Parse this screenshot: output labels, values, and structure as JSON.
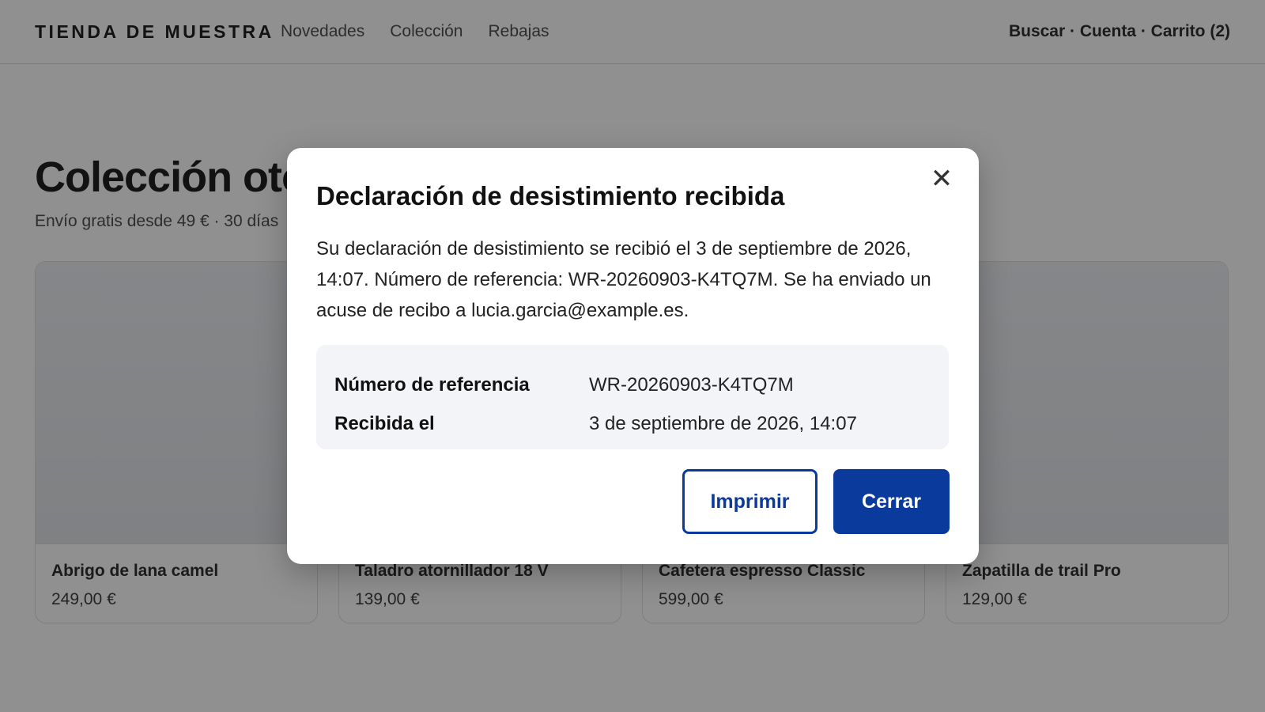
{
  "header": {
    "brand": "TIENDA DE MUESTRA",
    "nav": [
      "Novedades",
      "Colección",
      "Rebajas"
    ],
    "utility": "Buscar · Cuenta · Carrito (2)"
  },
  "main": {
    "title": "Colección otoño",
    "subtitle": "Envío gratis desde 49 € · 30 días"
  },
  "products": [
    {
      "name": "Abrigo de lana camel",
      "price": "249,00 €"
    },
    {
      "name": "Taladro atornillador 18 V",
      "price": "139,00 €"
    },
    {
      "name": "Cafetera espresso Classic",
      "price": "599,00 €"
    },
    {
      "name": "Zapatilla de trail Pro",
      "price": "129,00 €"
    }
  ],
  "modal": {
    "title": "Declaración de desistimiento recibida",
    "body": "Su declaración de desistimiento se recibió el 3 de septiembre de 2026, 14:07. Número de referencia: WR-20260903-K4TQ7M. Se ha enviado un acuse de recibo a lucia.garcia@example.es.",
    "close_icon": "close-icon",
    "details": [
      {
        "label": "Número de referencia",
        "value": "WR-20260903-K4TQ7M"
      },
      {
        "label": "Recibida el",
        "value": "3 de septiembre de 2026, 14:07"
      }
    ],
    "print_label": "Imprimir",
    "close_label": "Cerrar"
  },
  "colors": {
    "primary": "#0a3a9c",
    "overlay": "rgba(20,20,20,0.47)",
    "details_bg": "#f3f4f8"
  }
}
